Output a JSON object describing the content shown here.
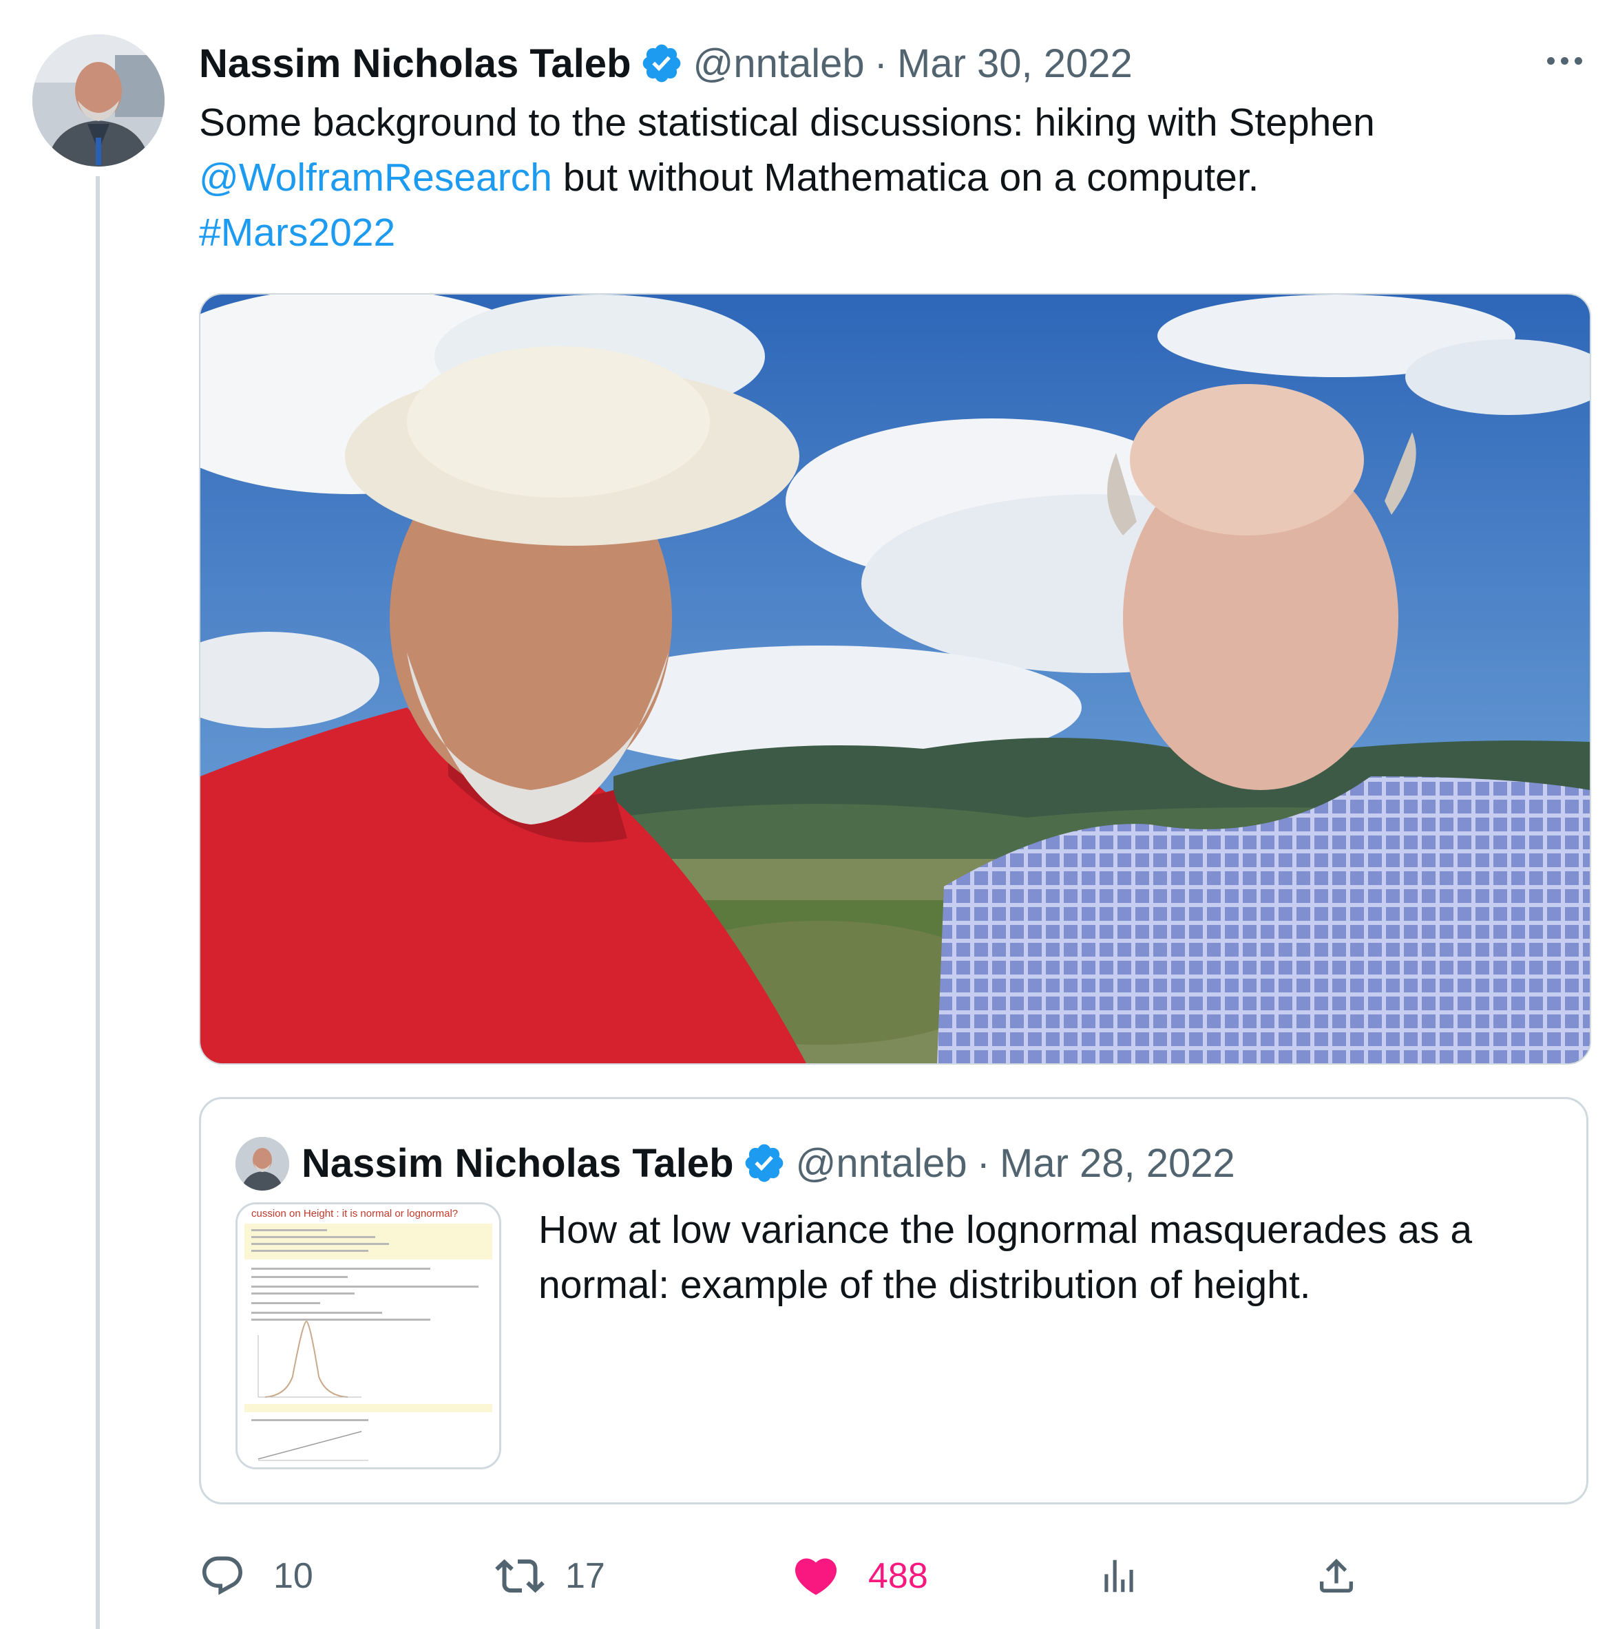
{
  "tweet": {
    "author_name": "Nassim Nicholas Taleb",
    "handle": "@nntaleb",
    "separator": "·",
    "date": "Mar 30, 2022",
    "text_part1": "Some background to the statistical discussions: hiking with Stephen",
    "mention": "@WolframResearch",
    "text_part2": " but without Mathematica on a computer.",
    "hashtag": "#Mars2022"
  },
  "quoted_tweet": {
    "author_name": "Nassim Nicholas Taleb",
    "handle": "@nntaleb",
    "separator": "·",
    "date": "Mar 28, 2022",
    "text": "How at low variance the lognormal masquerades as a normal: example of the distribution of height.",
    "thumbnail_title": "cussion on Height : it is normal or lognormal?"
  },
  "actions": {
    "replies": "10",
    "retweets": "17",
    "likes": "488"
  },
  "icons": [
    "more-icon",
    "verified-badge-icon",
    "reply-icon",
    "retweet-icon",
    "like-icon",
    "views-icon",
    "share-icon"
  ],
  "colors": {
    "link": "#1d9bf0",
    "like": "#f91880",
    "secondary_text": "#536471",
    "border": "#cfd9de"
  }
}
